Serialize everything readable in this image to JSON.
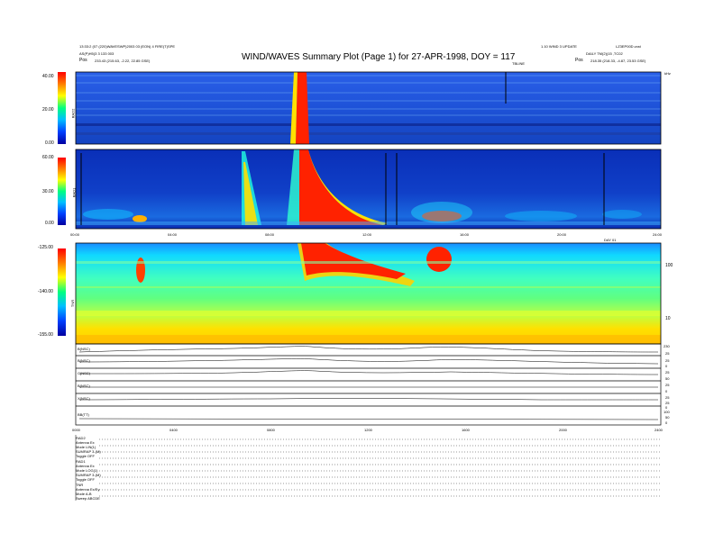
{
  "header": {
    "title": "WIND/WAVES Summary Plot (Page 1) for 27-APR-1998, DOY = 117",
    "left_line1": "13:33:2 (07 (220)WAVESWP)2003 03 (EON) 4 FIRE(T)SPE",
    "left_line2": "AS(P)H5(3 3 133 003",
    "left_pos_label": "Pos",
    "left_pos_value": "233.43 (215.63, -2.22, 22.85 GSE)",
    "center_right_line1": "1.10 WIND 3 UPDATE",
    "center_right_line2": "TBLINE",
    "right_line1": "LZ3EP00D.vcst",
    "right_line2": "DAILY TM(2)(15 ,TC02",
    "right_pos_label": "Pos",
    "right_pos_value": "218.35 (218.33, -4.87, 23.53 GSE)"
  },
  "panels": {
    "rad2": {
      "label": "RAD2",
      "ticks": [
        "40.00",
        "20.00",
        "0.00"
      ],
      "right_tick": "kHz"
    },
    "rad1": {
      "label": "RAD1",
      "ticks": [
        "60.00",
        "30.00",
        "0.00"
      ]
    },
    "tnr": {
      "label": "TNR",
      "ticks": [
        "-125.00",
        "-140.00",
        "-155.00"
      ],
      "right_ticks": [
        "100",
        "10"
      ]
    },
    "upper_time_ticks": [
      "00:00",
      "04:00",
      "08:00",
      "12:00",
      "16:00",
      "20:00",
      "24:00"
    ],
    "upper_time_marker": "DAY 01",
    "mag": {
      "labels": [
        "B(NSC)",
        "B(NSC)",
        "C(NSC)",
        "B(NSC)",
        "X(NSC)",
        "BB(TT)"
      ],
      "right_ticks": [
        "230",
        "25",
        "25",
        "0",
        "25",
        "50",
        "25",
        "0",
        "25",
        "25",
        "0",
        "100",
        "50",
        "0"
      ]
    },
    "lower_time_ticks": [
      "0000",
      "0400",
      "0800",
      "1200",
      "1600",
      "2000",
      "2400"
    ]
  },
  "footer": {
    "rows": [
      "RAD2",
      "Antenna  Ex",
      "Mode  LIN(1)",
      "SUMRAP 3-(M)",
      "Toggle  OFF",
      "RAD1",
      "Antenna  Ex",
      "Mode  LOG(1)",
      "SUMRAP 3-(M)",
      "Toggle  OFF",
      "TNR",
      "Antenna  Ex/Ey",
      "Mode  A-B",
      "Sweep  ABCDE"
    ]
  },
  "colors": {
    "colorbar": [
      "#0000a0",
      "#0040ff",
      "#00c0ff",
      "#00ff80",
      "#ffff00",
      "#ff8000",
      "#ff0000"
    ],
    "rad2_bg": "#1a4fd8",
    "rad1_bg": "#0a2fb8",
    "burst": "#ff2200",
    "tnr_bands": [
      "#ffe000",
      "#aaff30",
      "#40ffa0",
      "#10d8ff",
      "#1a8cff"
    ]
  },
  "chart_data": {
    "type": "heatmap",
    "title": "WIND/WAVES Summary Plot (Page 1) for 27-APR-1998, DOY = 117",
    "x": [
      "00:00",
      "04:00",
      "08:00",
      "12:00",
      "16:00",
      "20:00",
      "24:00"
    ],
    "series": [
      {
        "name": "RAD2",
        "ylim": [
          0,
          40
        ]
      },
      {
        "name": "RAD1",
        "ylim": [
          0,
          60
        ]
      },
      {
        "name": "TNR",
        "ylim": [
          -155,
          -125
        ]
      }
    ]
  }
}
